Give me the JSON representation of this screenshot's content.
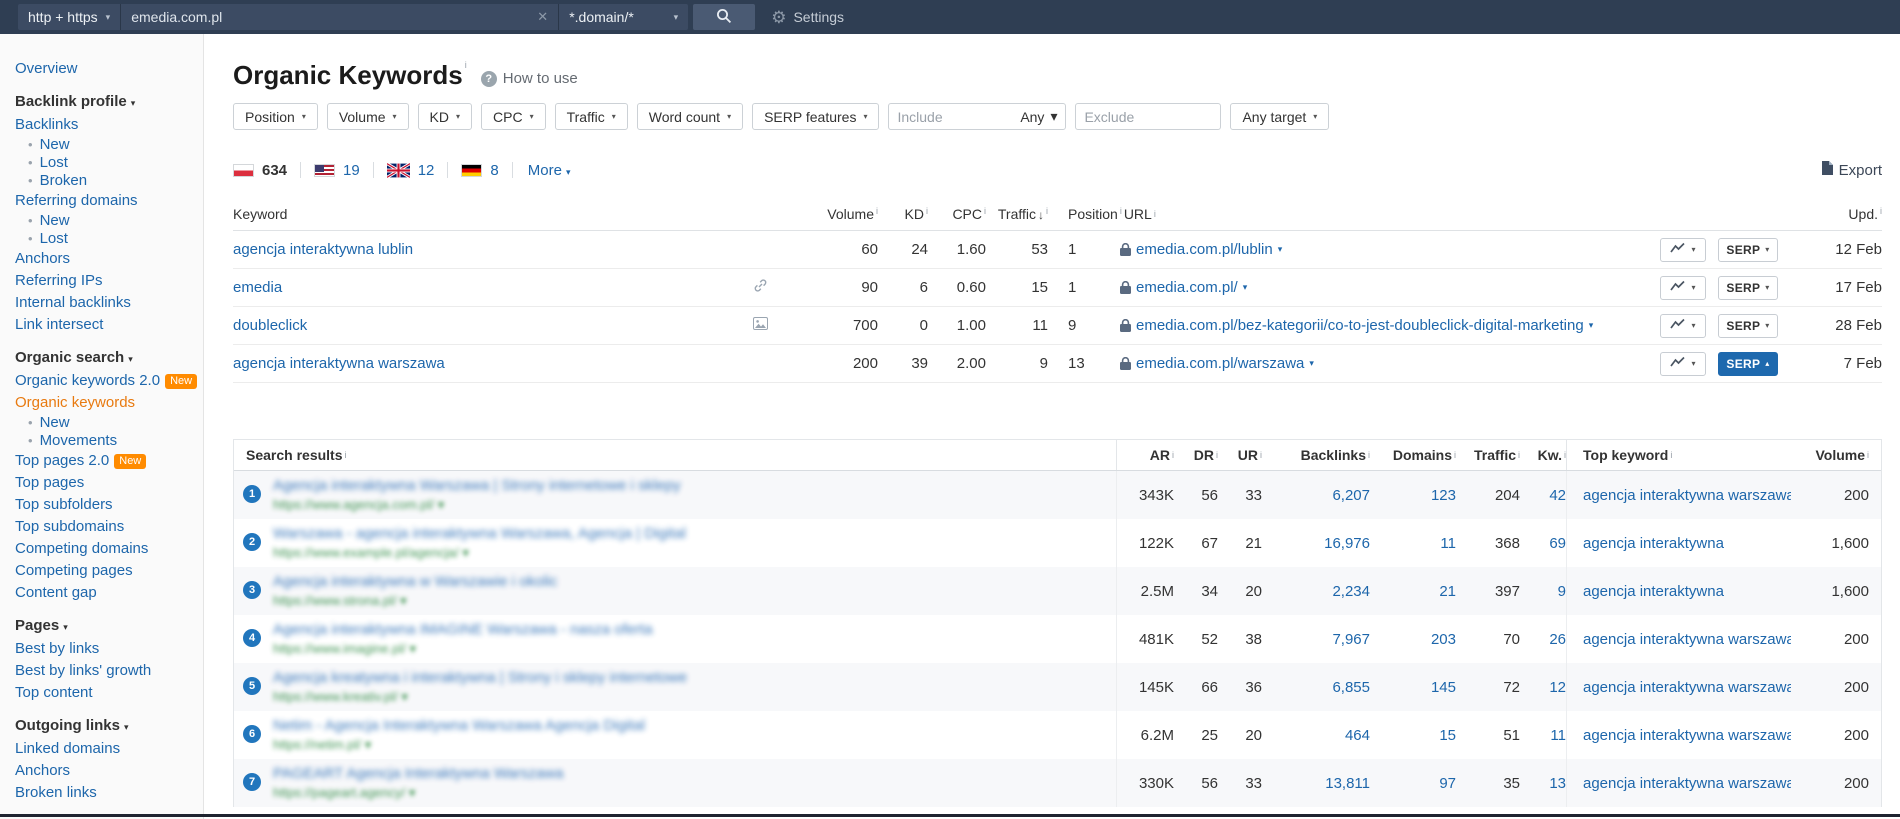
{
  "topbar": {
    "protocol": "http + https",
    "search_value": "emedia.com.pl",
    "scope": "*.domain/*",
    "settings_label": "Settings"
  },
  "page": {
    "title": "Organic Keywords",
    "howto_label": "How to use"
  },
  "filters": {
    "buttons": [
      "Position",
      "Volume",
      "KD",
      "CPC",
      "Traffic",
      "Word count",
      "SERP features"
    ],
    "include_placeholder": "Include",
    "include_any_label": "Any",
    "exclude_placeholder": "Exclude",
    "target_label": "Any target"
  },
  "countries": {
    "items": [
      {
        "code": "pl",
        "name": "poland-flag",
        "count": "634",
        "active": true
      },
      {
        "code": "us",
        "name": "usa-flag",
        "count": "19",
        "active": false
      },
      {
        "code": "gb",
        "name": "uk-flag",
        "count": "12",
        "active": false
      },
      {
        "code": "de",
        "name": "germany-flag",
        "count": "8",
        "active": false
      }
    ],
    "more_label": "More",
    "export_label": "Export"
  },
  "sidebar": {
    "items": [
      {
        "type": "link",
        "label": "Overview"
      },
      {
        "type": "heading",
        "label": "Backlink profile"
      },
      {
        "type": "link",
        "label": "Backlinks"
      },
      {
        "type": "sub",
        "label": "New"
      },
      {
        "type": "sub",
        "label": "Lost"
      },
      {
        "type": "sub",
        "label": "Broken"
      },
      {
        "type": "link",
        "label": "Referring domains"
      },
      {
        "type": "sub",
        "label": "New"
      },
      {
        "type": "sub",
        "label": "Lost"
      },
      {
        "type": "link",
        "label": "Anchors"
      },
      {
        "type": "link",
        "label": "Referring IPs"
      },
      {
        "type": "link",
        "label": "Internal backlinks"
      },
      {
        "type": "link",
        "label": "Link intersect"
      },
      {
        "type": "heading",
        "label": "Organic search"
      },
      {
        "type": "link",
        "label": "Organic keywords 2.0",
        "badge": "New"
      },
      {
        "type": "link",
        "label": "Organic keywords",
        "active": true
      },
      {
        "type": "sub",
        "label": "New"
      },
      {
        "type": "sub",
        "label": "Movements"
      },
      {
        "type": "link",
        "label": "Top pages 2.0",
        "badge": "New"
      },
      {
        "type": "link",
        "label": "Top pages"
      },
      {
        "type": "link",
        "label": "Top subfolders"
      },
      {
        "type": "link",
        "label": "Top subdomains"
      },
      {
        "type": "link",
        "label": "Competing domains"
      },
      {
        "type": "link",
        "label": "Competing pages"
      },
      {
        "type": "link",
        "label": "Content gap"
      },
      {
        "type": "heading",
        "label": "Pages"
      },
      {
        "type": "link",
        "label": "Best by links"
      },
      {
        "type": "link",
        "label": "Best by links' growth"
      },
      {
        "type": "link",
        "label": "Top content"
      },
      {
        "type": "heading",
        "label": "Outgoing links"
      },
      {
        "type": "link",
        "label": "Linked domains"
      },
      {
        "type": "link",
        "label": "Anchors"
      },
      {
        "type": "link",
        "label": "Broken links"
      }
    ]
  },
  "keywords_table": {
    "headers": {
      "keyword": "Keyword",
      "volume": "Volume",
      "kd": "KD",
      "cpc": "CPC",
      "traffic": "Traffic",
      "position": "Position",
      "url": "URL",
      "upd": "Upd."
    },
    "serp_button_label": "SERP",
    "rows": [
      {
        "keyword": "agencja interaktywna lublin",
        "icon": null,
        "volume": "60",
        "kd": "24",
        "cpc": "1.60",
        "traffic": "53",
        "position": "1",
        "url": "emedia.com.pl/lublin",
        "upd": "12 Feb",
        "serp_open": false
      },
      {
        "keyword": "emedia",
        "icon": "link",
        "volume": "90",
        "kd": "6",
        "cpc": "0.60",
        "traffic": "15",
        "position": "1",
        "url": "emedia.com.pl/",
        "upd": "17 Feb",
        "serp_open": false
      },
      {
        "keyword": "doubleclick",
        "icon": "image",
        "volume": "700",
        "kd": "0",
        "cpc": "1.00",
        "traffic": "11",
        "position": "9",
        "url": "emedia.com.pl/bez-kategorii/co-to-jest-doubleclick-digital-marketing",
        "upd": "28 Feb",
        "serp_open": false
      },
      {
        "keyword": "agencja interaktywna warszawa",
        "icon": null,
        "volume": "200",
        "kd": "39",
        "cpc": "2.00",
        "traffic": "9",
        "position": "13",
        "url": "emedia.com.pl/warszawa",
        "upd": "7 Feb",
        "serp_open": true
      }
    ]
  },
  "serp_results": {
    "title": "Search results",
    "headers": {
      "ar": "AR",
      "dr": "DR",
      "ur": "UR",
      "backlinks": "Backlinks",
      "domains": "Domains",
      "traffic": "Traffic",
      "kw": "Kw.",
      "top_keyword": "Top keyword",
      "volume": "Volume"
    },
    "rows": [
      {
        "pos": "1",
        "redacted_title": "Agencja interaktywna Warszawa | Strony internetowe i sklepy",
        "redacted_url": "https://www.agencja.com.pl/ ▾",
        "ar": "343K",
        "dr": "56",
        "ur": "33",
        "backlinks": "6,207",
        "domains": "123",
        "traffic": "204",
        "kw": "42",
        "top_keyword": "agencja interaktywna warszawa",
        "volume": "200"
      },
      {
        "pos": "2",
        "redacted_title": "Warszawa - agencja interaktywna Warszawa, Agencja | Digital",
        "redacted_url": "https://www.example.pl/agencja/ ▾",
        "ar": "122K",
        "dr": "67",
        "ur": "21",
        "backlinks": "16,976",
        "domains": "11",
        "traffic": "368",
        "kw": "69",
        "top_keyword": "agencja interaktywna",
        "volume": "1,600"
      },
      {
        "pos": "3",
        "redacted_title": "Agencja interaktywna w Warszawie i okolic",
        "redacted_url": "https://www.strona.pl/ ▾",
        "ar": "2.5M",
        "dr": "34",
        "ur": "20",
        "backlinks": "2,234",
        "domains": "21",
        "traffic": "397",
        "kw": "9",
        "top_keyword": "agencja interaktywna",
        "volume": "1,600"
      },
      {
        "pos": "4",
        "redacted_title": "Agencja interaktywna IMAGINE Warszawa - nasza oferta",
        "redacted_url": "https://www.imagine.pl/ ▾",
        "ar": "481K",
        "dr": "52",
        "ur": "38",
        "backlinks": "7,967",
        "domains": "203",
        "traffic": "70",
        "kw": "26",
        "top_keyword": "agencja interaktywna warszawa",
        "volume": "200"
      },
      {
        "pos": "5",
        "redacted_title": "Agencja kreatywna i interaktywna | Strony i sklepy internetowe",
        "redacted_url": "https://www.kreativ.pl/ ▾",
        "ar": "145K",
        "dr": "66",
        "ur": "36",
        "backlinks": "6,855",
        "domains": "145",
        "traffic": "72",
        "kw": "12",
        "top_keyword": "agencja interaktywna warszawa",
        "volume": "200"
      },
      {
        "pos": "6",
        "redacted_title": "Netim - Agencja Interaktywna Warszawa Agencja Digital",
        "redacted_url": "https://netim.pl/ ▾",
        "ar": "6.2M",
        "dr": "25",
        "ur": "20",
        "backlinks": "464",
        "domains": "15",
        "traffic": "51",
        "kw": "11",
        "top_keyword": "agencja interaktywna warszawa",
        "volume": "200"
      },
      {
        "pos": "7",
        "redacted_title": "PAGEART Agencja Interaktywna Warszawa",
        "redacted_url": "https://pageart.agency/ ▾",
        "ar": "330K",
        "dr": "56",
        "ur": "33",
        "backlinks": "13,811",
        "domains": "97",
        "traffic": "35",
        "kw": "13",
        "top_keyword": "agencja interaktywna warszawa",
        "volume": "200"
      }
    ]
  }
}
